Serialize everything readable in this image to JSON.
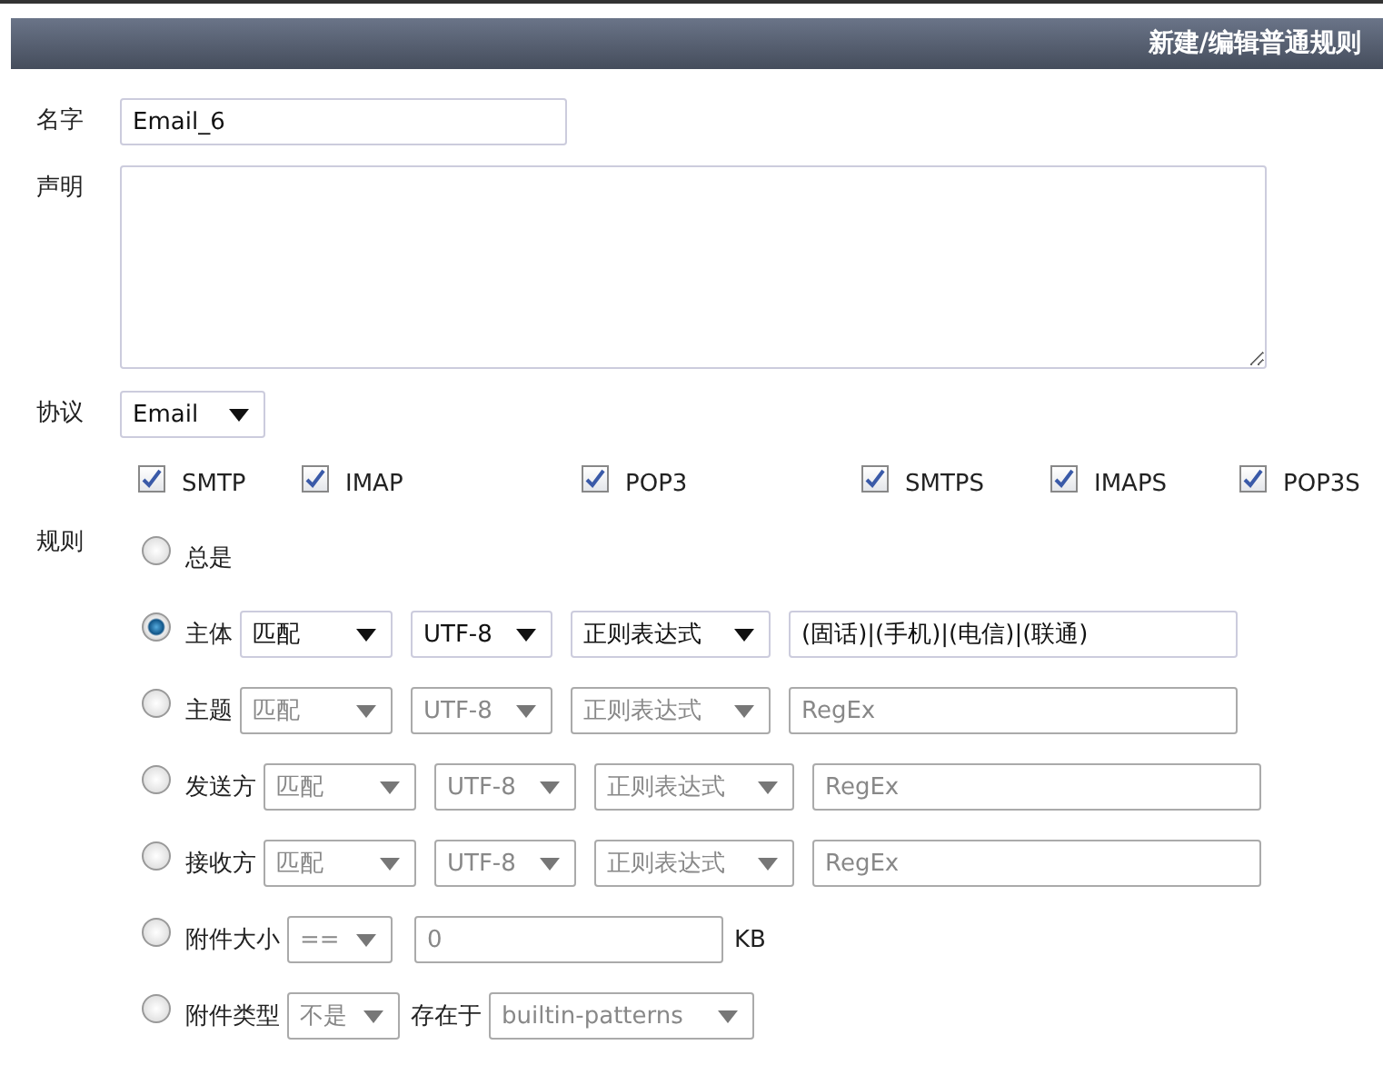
{
  "header": {
    "title": "新建/编辑普通规则"
  },
  "name": {
    "label": "名字",
    "value": "Email_6"
  },
  "description": {
    "label": "声明"
  },
  "protocol": {
    "label": "协议",
    "value": "Email"
  },
  "protocols": [
    {
      "label": "SMTP",
      "checked": true
    },
    {
      "label": "IMAP",
      "checked": true
    },
    {
      "label": "POP3",
      "checked": true
    },
    {
      "label": "SMTPS",
      "checked": true
    },
    {
      "label": "IMAPS",
      "checked": true
    },
    {
      "label": "POP3S",
      "checked": true
    }
  ],
  "rules": {
    "label": "规则",
    "items": [
      {
        "kind": "always",
        "label": "总是",
        "selected": false
      },
      {
        "kind": "match",
        "label": "主体",
        "selected": true,
        "disabled": false,
        "match": "匹配",
        "encoding": "UTF-8",
        "mode": "正则表达式",
        "pattern": "(固话)|(手机)|(电信)|(联通)"
      },
      {
        "kind": "match",
        "label": "主题",
        "selected": false,
        "disabled": true,
        "match": "匹配",
        "encoding": "UTF-8",
        "mode": "正则表达式",
        "placeholder": "RegEx"
      },
      {
        "kind": "match",
        "label": "发送方",
        "selected": false,
        "disabled": true,
        "match": "匹配",
        "encoding": "UTF-8",
        "mode": "正则表达式",
        "placeholder": "RegEx"
      },
      {
        "kind": "match",
        "label": "接收方",
        "selected": false,
        "disabled": true,
        "match": "匹配",
        "encoding": "UTF-8",
        "mode": "正则表达式",
        "placeholder": "RegEx"
      },
      {
        "kind": "size",
        "label": "附件大小",
        "selected": false,
        "disabled": true,
        "operator": "==",
        "value": "0",
        "unit": "KB"
      },
      {
        "kind": "type",
        "label": "附件类型",
        "selected": false,
        "disabled": true,
        "operator": "不是",
        "location_label": "存在于",
        "patterns": "builtin-patterns"
      }
    ]
  }
}
